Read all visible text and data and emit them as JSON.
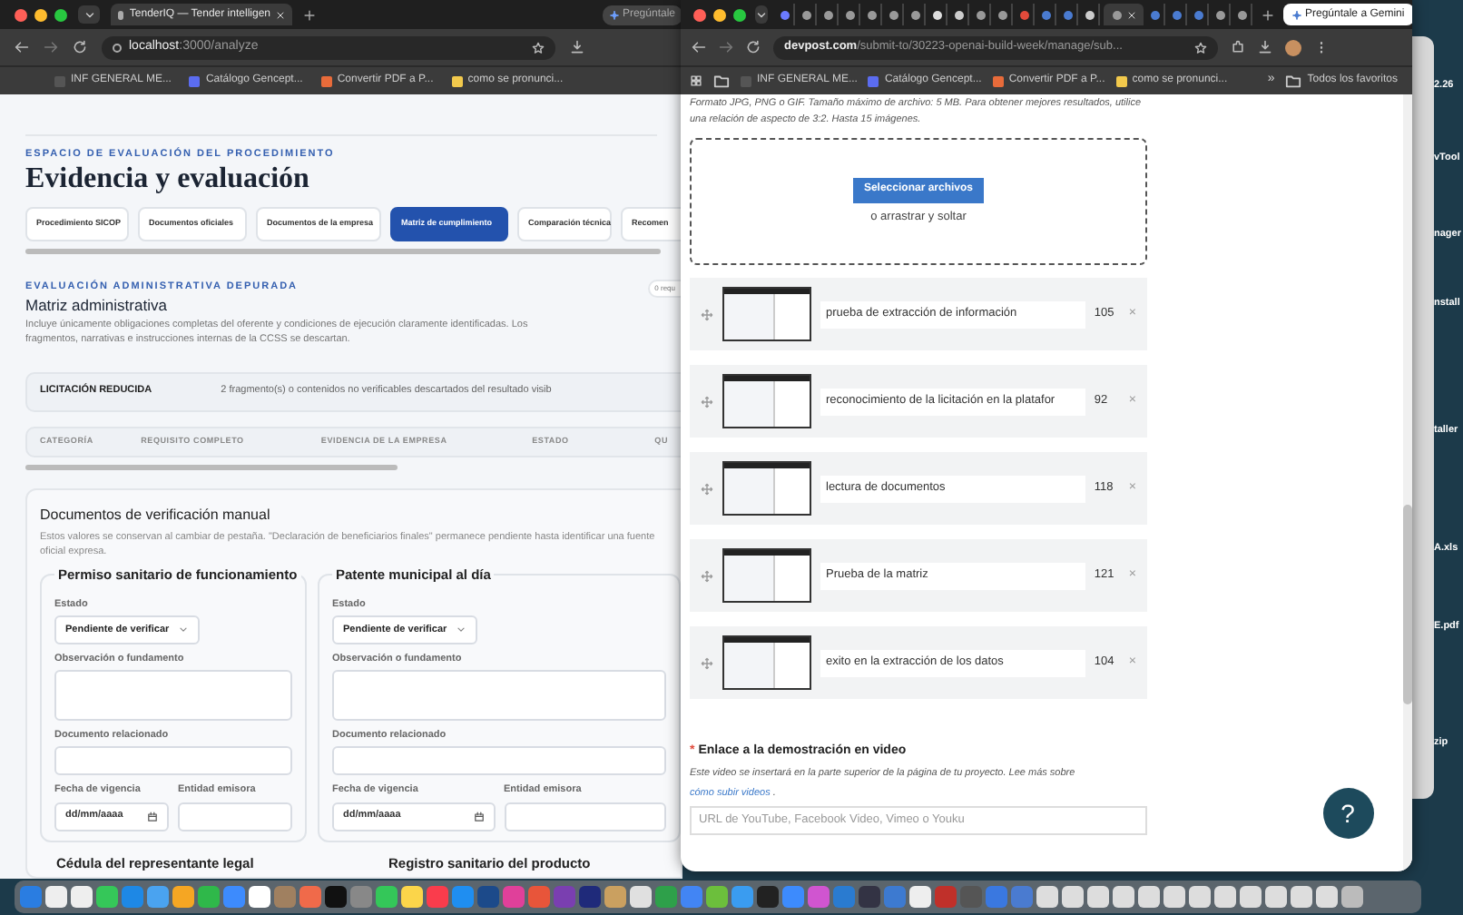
{
  "left_window": {
    "tab": {
      "title": "TenderIQ — Tender intelligen",
      "selected": true
    },
    "assistant_button": "Pregúntale",
    "address": {
      "host": "localhost",
      "path": ":3000/analyze"
    },
    "bookmarks": [
      "INF GENERAL ME...",
      "Catálogo Gencept...",
      "Convertir PDF a P...",
      "como se pronunci..."
    ],
    "eyebrow": "ESPACIO DE EVALUACIÓN DEL PROCEDIMIENTO",
    "title": "Evidencia y evaluación",
    "tabs": [
      {
        "label": "Procedimiento SICOP",
        "selected": false
      },
      {
        "label": "Documentos oficiales",
        "selected": false
      },
      {
        "label": "Documentos de la empresa",
        "selected": false
      },
      {
        "label": "Matriz de cumplimiento",
        "selected": true
      },
      {
        "label": "Comparación técnica",
        "selected": false
      },
      {
        "label": "Recomen",
        "selected": false
      }
    ],
    "section": {
      "eyebrow": "EVALUACIÓN ADMINISTRATIVA DEPURADA",
      "title": "Matriz administrativa",
      "description": "Incluye únicamente obligaciones completas del oferente y condiciones de ejecución claramente identificadas. Los fragmentos, narrativas e instrucciones internas de la CCSS se descartan.",
      "badge": "0 requ"
    },
    "banner": {
      "title": "LICITACIÓN REDUCIDA",
      "note": "2 fragmento(s) o contenidos no verificables descartados del resultado visib"
    },
    "table": {
      "columns": [
        "CATEGORÍA",
        "REQUISITO COMPLETO",
        "EVIDENCIA DE LA EMPRESA",
        "ESTADO",
        "QU"
      ]
    },
    "manual": {
      "title": "Documentos de verificación manual",
      "description": "Estos valores se conservan al cambiar de pestaña. \"Declaración de beneficiarios finales\" permanece pendiente hasta identificar una fuente oficial expresa.",
      "cards": [
        {
          "title": "Permiso sanitario de funcionamiento",
          "fields": [
            {
              "kind": "select",
              "label": "Estado",
              "value": "Pendiente de verificar"
            },
            {
              "kind": "textarea",
              "label": "Observación o fundamento"
            },
            {
              "kind": "text",
              "label": "Documento relacionado"
            }
          ],
          "row": [
            {
              "kind": "date",
              "label": "Fecha de vigencia",
              "placeholder": "dd/mm/aaaa"
            },
            {
              "kind": "text",
              "label": "Entidad emisora"
            }
          ]
        },
        {
          "title": "Patente municipal al día",
          "fields": [
            {
              "kind": "select",
              "label": "Estado",
              "value": "Pendiente de verificar"
            },
            {
              "kind": "textarea",
              "label": "Observación o fundamento"
            },
            {
              "kind": "text",
              "label": "Documento relacionado"
            }
          ],
          "row": [
            {
              "kind": "date",
              "label": "Fecha de vigencia",
              "placeholder": "dd/mm/aaaa"
            },
            {
              "kind": "text",
              "label": "Entidad emisora"
            }
          ]
        }
      ],
      "next_cards": [
        "Cédula del representante legal",
        "Registro sanitario del producto"
      ]
    }
  },
  "right_window": {
    "tabs": [
      {
        "selected": false
      },
      {
        "selected": false
      },
      {
        "selected": false
      },
      {
        "selected": false
      },
      {
        "selected": false
      },
      {
        "selected": false
      },
      {
        "selected": false
      },
      {
        "selected": false
      },
      {
        "selected": false
      },
      {
        "selected": false
      },
      {
        "selected": false
      },
      {
        "selected": false
      },
      {
        "selected": false
      },
      {
        "selected": false
      },
      {
        "selected": false
      },
      {
        "selected": true
      },
      {
        "selected": false
      },
      {
        "selected": false
      },
      {
        "selected": false
      },
      {
        "selected": false
      },
      {
        "selected": false
      }
    ],
    "assistant_button": "Pregúntale a Gemini",
    "address": {
      "host": "devpost.com",
      "path": "/submit-to/30223-openai-build-week/manage/sub..."
    },
    "bookmarks": [
      "INF GENERAL ME...",
      "Catálogo Gencept...",
      "Convertir PDF a P...",
      "como se pronunci..."
    ],
    "more_bookmarks": "»",
    "all_bookmarks": "Todos los favoritos",
    "intro": "Formato JPG, PNG o GIF. Tamaño máximo de archivo: 5 MB. Para obtener mejores resultados, utilice una relación de aspecto de 3:2. Hasta 15 imágenes.",
    "upload": {
      "button": "Seleccionar archivos",
      "hint": "o arrastrar y soltar"
    },
    "images": [
      {
        "caption": "prueba de extracción de información",
        "count": "105",
        "remove": "×"
      },
      {
        "caption": "reconocimiento de la licitación en la platafor",
        "count": "92",
        "remove": "×"
      },
      {
        "caption": "lectura de documentos",
        "count": "118",
        "remove": "×"
      },
      {
        "caption": "Prueba de la matriz",
        "count": "121",
        "remove": "×"
      },
      {
        "caption": "exito en la extracción de los datos",
        "count": "104",
        "remove": "×"
      }
    ],
    "video": {
      "required_mark": "*",
      "label": "Enlace a la demostración en video",
      "description": "Este video se insertará en la parte superior de la página de tu proyecto. Lee más sobre",
      "link": "cómo subir videos",
      "after_link": ".",
      "placeholder": "URL de YouTube, Facebook Video, Vimeo o Youku"
    },
    "help_button": "?"
  },
  "desktop_labels": [
    "2.26",
    "vTool",
    "nager",
    "nstall",
    "taller",
    "A.xls",
    "E.pdf",
    "zip"
  ]
}
